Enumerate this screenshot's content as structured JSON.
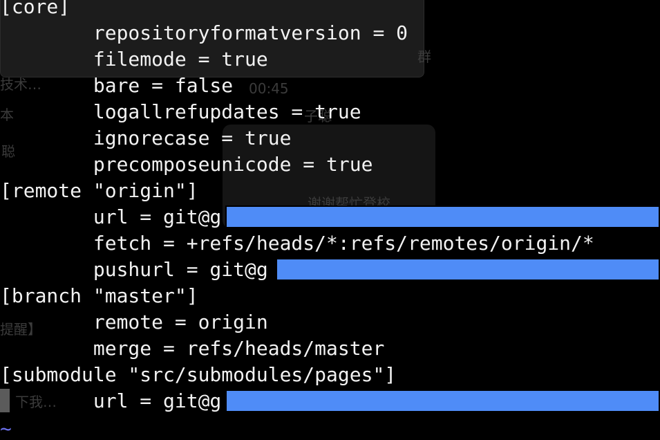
{
  "background_window": {
    "fragments": [
      "技术…",
      "本",
      "聪",
      "00:45",
      "子聪",
      "谢谢帮忙登校",
      "提醒】",
      "下我…",
      "群"
    ]
  },
  "terminal": {
    "lines": [
      "[core]",
      "        repositoryformatversion = 0",
      "        filemode = true",
      "        bare = false",
      "        logallrefupdates = true",
      "        ignorecase = true",
      "        precomposeunicode = true",
      "[remote \"origin\"]",
      "        url = git@g",
      "        fetch = +refs/heads/*:refs/remotes/origin/*",
      "        pushurl = git@g",
      "[branch \"master\"]",
      "        remote = origin",
      "        merge = refs/heads/master",
      "[submodule \"src/submodules/pages\"]",
      "        url = git@g"
    ],
    "empty_line_marker": "~"
  },
  "colors": {
    "background": "#000000",
    "text": "#f2f2f2",
    "redaction": "#4f8cf7",
    "tilde": "#6d72f0"
  }
}
